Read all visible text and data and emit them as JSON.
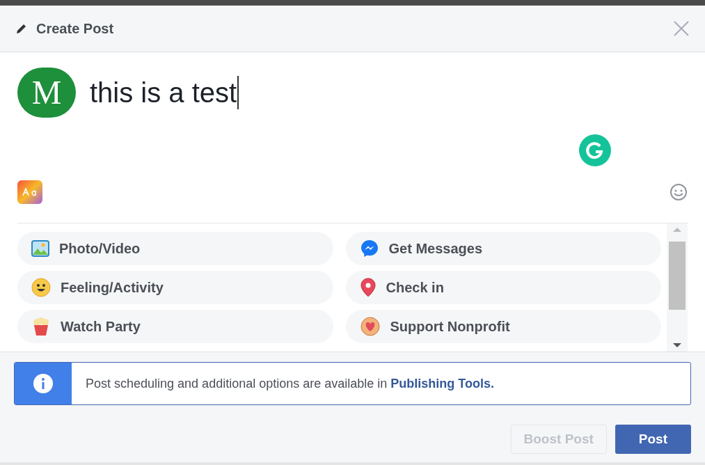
{
  "dialog": {
    "title": "Create Post"
  },
  "composer": {
    "avatar_letter": "M",
    "value": "this is a test"
  },
  "options": [
    {
      "label": "Photo/Video",
      "kind": "photo"
    },
    {
      "label": "Get Messages",
      "kind": "messenger"
    },
    {
      "label": "Feeling/Activity",
      "kind": "feeling"
    },
    {
      "label": "Check in",
      "kind": "checkin"
    },
    {
      "label": "Watch Party",
      "kind": "party"
    },
    {
      "label": "Support Nonprofit",
      "kind": "nonprofit"
    }
  ],
  "notice": {
    "text": "Post scheduling and additional options are available in",
    "link": "Publishing Tools."
  },
  "buttons": [
    {
      "label": "Boost Post",
      "disabled": true
    },
    {
      "label": "Post",
      "disabled": false
    }
  ]
}
